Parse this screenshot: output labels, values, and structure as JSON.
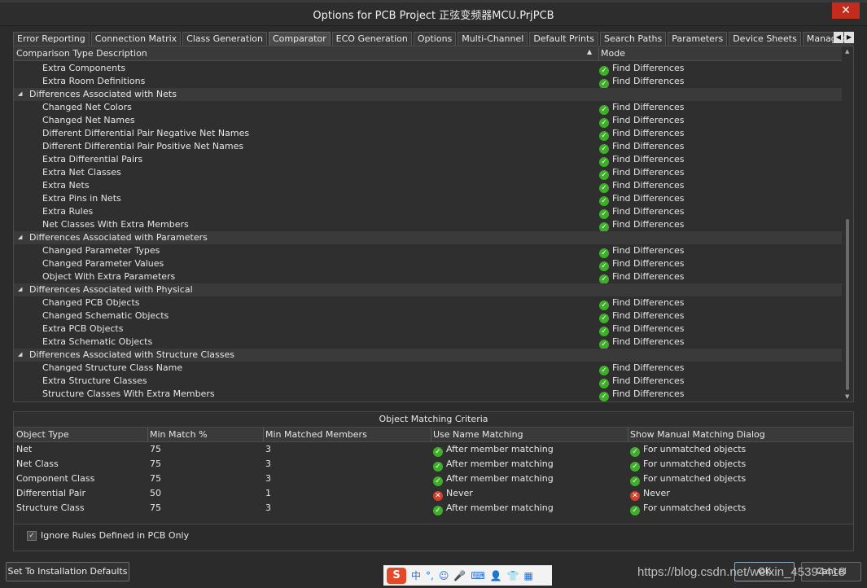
{
  "window": {
    "title": "Options for PCB Project 正弦变频器MCU.PrjPCB",
    "close": "✕"
  },
  "tabs": [
    "Error Reporting",
    "Connection Matrix",
    "Class Generation",
    "Comparator",
    "ECO Generation",
    "Options",
    "Multi-Channel",
    "Default Prints",
    "Search Paths",
    "Parameters",
    "Device Sheets",
    "Managed Outpu"
  ],
  "active_tab": "Comparator",
  "comparison": {
    "col_description": "Comparison Type Description",
    "col_mode": "Mode",
    "rows": [
      {
        "type": "item",
        "label": "Extra Components",
        "mode": "Find Differences"
      },
      {
        "type": "item",
        "label": "Extra Room Definitions",
        "mode": "Find Differences"
      },
      {
        "type": "group",
        "label": "Differences Associated with Nets",
        "mode": ""
      },
      {
        "type": "item",
        "label": "Changed Net Colors",
        "mode": "Find Differences"
      },
      {
        "type": "item",
        "label": "Changed Net Names",
        "mode": "Find Differences"
      },
      {
        "type": "item",
        "label": "Different Differential Pair Negative Net Names",
        "mode": "Find Differences"
      },
      {
        "type": "item",
        "label": "Different Differential Pair Positive Net Names",
        "mode": "Find Differences"
      },
      {
        "type": "item",
        "label": "Extra Differential Pairs",
        "mode": "Find Differences"
      },
      {
        "type": "item",
        "label": "Extra Net Classes",
        "mode": "Find Differences"
      },
      {
        "type": "item",
        "label": "Extra Nets",
        "mode": "Find Differences"
      },
      {
        "type": "item",
        "label": "Extra Pins in Nets",
        "mode": "Find Differences"
      },
      {
        "type": "item",
        "label": "Extra Rules",
        "mode": "Find Differences"
      },
      {
        "type": "item",
        "label": "Net Classes With Extra Members",
        "mode": "Find Differences"
      },
      {
        "type": "group",
        "label": "Differences Associated with Parameters",
        "mode": ""
      },
      {
        "type": "item",
        "label": "Changed Parameter Types",
        "mode": "Find Differences"
      },
      {
        "type": "item",
        "label": "Changed Parameter Values",
        "mode": "Find Differences"
      },
      {
        "type": "item",
        "label": "Object With Extra Parameters",
        "mode": "Find Differences"
      },
      {
        "type": "group",
        "label": "Differences Associated with Physical",
        "mode": ""
      },
      {
        "type": "item",
        "label": "Changed PCB Objects",
        "mode": "Find Differences"
      },
      {
        "type": "item",
        "label": "Changed Schematic Objects",
        "mode": "Find Differences"
      },
      {
        "type": "item",
        "label": "Extra PCB Objects",
        "mode": "Find Differences"
      },
      {
        "type": "item",
        "label": "Extra Schematic Objects",
        "mode": "Find Differences"
      },
      {
        "type": "group",
        "label": "Differences Associated with Structure Classes",
        "mode": ""
      },
      {
        "type": "item",
        "label": "Changed Structure Class Name",
        "mode": "Find Differences"
      },
      {
        "type": "item",
        "label": "Extra Structure Classes",
        "mode": "Find Differences"
      },
      {
        "type": "item",
        "label": "Structure Classes With Extra Members",
        "mode": "Find Differences"
      }
    ]
  },
  "matching": {
    "title": "Object Matching Criteria",
    "headers": [
      "Object Type",
      "Min Match %",
      "Min Matched Members",
      "Use Name Matching",
      "Show Manual Matching Dialog"
    ],
    "rows": [
      {
        "type": "Net",
        "min_match": "75",
        "min_members": "3",
        "name_matching": "After member matching",
        "name_ok": true,
        "dialog": "For unmatched objects",
        "dialog_ok": true
      },
      {
        "type": "Net Class",
        "min_match": "75",
        "min_members": "3",
        "name_matching": "After member matching",
        "name_ok": true,
        "dialog": "For unmatched objects",
        "dialog_ok": true
      },
      {
        "type": "Component Class",
        "min_match": "75",
        "min_members": "3",
        "name_matching": "After member matching",
        "name_ok": true,
        "dialog": "For unmatched objects",
        "dialog_ok": true
      },
      {
        "type": "Differential Pair",
        "min_match": "50",
        "min_members": "1",
        "name_matching": "Never",
        "name_ok": false,
        "dialog": "Never",
        "dialog_ok": false
      },
      {
        "type": "Structure Class",
        "min_match": "75",
        "min_members": "3",
        "name_matching": "After member matching",
        "name_ok": true,
        "dialog": "For unmatched objects",
        "dialog_ok": true
      }
    ]
  },
  "ignore_rules": {
    "label": "Ignore Rules Defined in PCB Only",
    "checked": true,
    "check_glyph": "✓"
  },
  "buttons": {
    "defaults": "Set To Installation Defaults",
    "ok": "OK",
    "cancel": "Cancel"
  },
  "ime": {
    "logo": "S",
    "items": [
      "中",
      "°,",
      "☺",
      "🎤",
      "⌨",
      "👤",
      "👕",
      "▦"
    ]
  },
  "watermark": "https://blog.csdn.net/weixin_45394418"
}
